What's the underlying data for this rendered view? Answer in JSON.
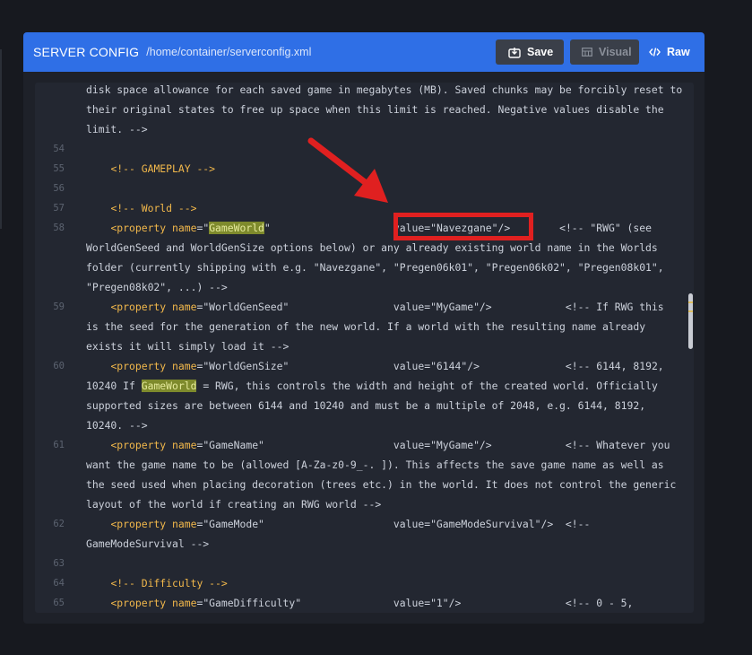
{
  "header": {
    "title": "SERVER CONFIG",
    "path": "/home/container/serverconfig.xml",
    "save_label": "Save",
    "visual_label": "Visual",
    "raw_label": "Raw"
  },
  "colors": {
    "header": "#2f6fe6",
    "editor_bg": "#232731",
    "tag": "#f2b84b",
    "highlight": "#7e8a2c",
    "annotation": "#e02020"
  },
  "editor": {
    "lines": [
      {
        "n": "",
        "text": "disk space allowance for each saved game in megabytes (MB). Saved chunks may be forcibly reset to"
      },
      {
        "n": "",
        "text": "their original states to free up space when this limit is reached. Negative values disable the"
      },
      {
        "n": "",
        "text": "limit. -->"
      },
      {
        "n": "54",
        "text": ""
      },
      {
        "n": "55",
        "text": "    <!-- GAMEPLAY -->"
      },
      {
        "n": "56",
        "text": ""
      },
      {
        "n": "57",
        "text": "    <!-- World -->"
      },
      {
        "n": "58",
        "text": "    <property name=\"GameWorld\"                    value=\"Navezgane\"/>        <!-- \"RWG\" (see"
      },
      {
        "n": "",
        "text": "WorldGenSeed and WorldGenSize options below) or any already existing world name in the Worlds"
      },
      {
        "n": "",
        "text": "folder (currently shipping with e.g. \"Navezgane\", \"Pregen06k01\", \"Pregen06k02\", \"Pregen08k01\","
      },
      {
        "n": "",
        "text": "\"Pregen08k02\", ...) -->"
      },
      {
        "n": "59",
        "text": "    <property name=\"WorldGenSeed\"                 value=\"MyGame\"/>            <!-- If RWG this"
      },
      {
        "n": "",
        "text": "is the seed for the generation of the new world. If a world with the resulting name already"
      },
      {
        "n": "",
        "text": "exists it will simply load it -->"
      },
      {
        "n": "60",
        "text": "    <property name=\"WorldGenSize\"                 value=\"6144\"/>              <!-- 6144, 8192,"
      },
      {
        "n": "",
        "text": "10240 If GameWorld = RWG, this controls the width and height of the created world. Officially"
      },
      {
        "n": "",
        "text": "supported sizes are between 6144 and 10240 and must be a multiple of 2048, e.g. 6144, 8192,"
      },
      {
        "n": "",
        "text": "10240. -->"
      },
      {
        "n": "61",
        "text": "    <property name=\"GameName\"                     value=\"MyGame\"/>            <!-- Whatever you"
      },
      {
        "n": "",
        "text": "want the game name to be (allowed [A-Za-z0-9_-. ]). This affects the save game name as well as"
      },
      {
        "n": "",
        "text": "the seed used when placing decoration (trees etc.) in the world. It does not control the generic"
      },
      {
        "n": "",
        "text": "layout of the world if creating an RWG world -->"
      },
      {
        "n": "62",
        "text": "    <property name=\"GameMode\"                     value=\"GameModeSurvival\"/>  <!--"
      },
      {
        "n": "",
        "text": "GameModeSurvival -->"
      },
      {
        "n": "63",
        "text": ""
      },
      {
        "n": "64",
        "text": "    <!-- Difficulty -->"
      },
      {
        "n": "65",
        "text": "    <property name=\"GameDifficulty\"               value=\"1\"/>                 <!-- 0 - 5,"
      }
    ]
  }
}
